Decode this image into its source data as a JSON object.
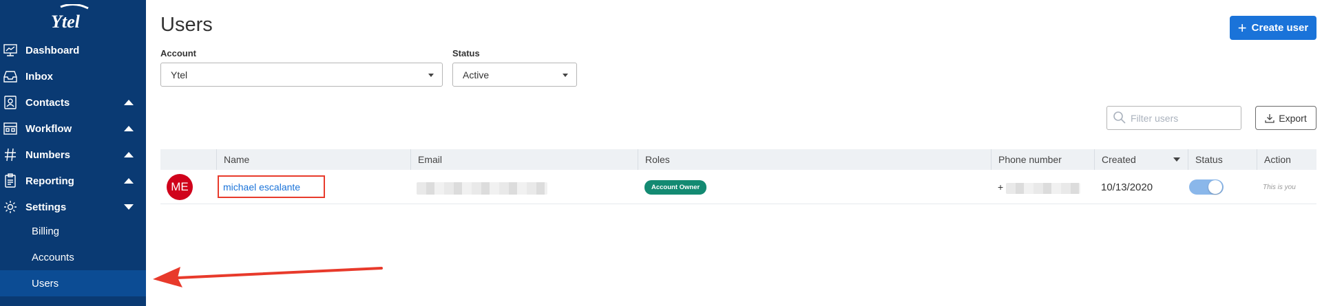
{
  "sidebar": {
    "logo_text": "Ytel",
    "items": [
      {
        "label": "Dashboard",
        "icon": "dashboard-icon"
      },
      {
        "label": "Inbox",
        "icon": "inbox-icon"
      },
      {
        "label": "Contacts",
        "icon": "contacts-icon",
        "caret": "up"
      },
      {
        "label": "Workflow",
        "icon": "workflow-icon",
        "caret": "up"
      },
      {
        "label": "Numbers",
        "icon": "hash-icon",
        "caret": "up"
      },
      {
        "label": "Reporting",
        "icon": "reporting-icon",
        "caret": "up"
      },
      {
        "label": "Settings",
        "icon": "gear-icon",
        "caret": "down"
      }
    ],
    "sub_items": [
      {
        "label": "Billing"
      },
      {
        "label": "Accounts"
      },
      {
        "label": "Users",
        "active": true
      }
    ]
  },
  "header": {
    "title": "Users",
    "create_label": "Create user"
  },
  "filters": {
    "account_label": "Account",
    "account_value": "Ytel",
    "status_label": "Status",
    "status_value": "Active",
    "search_placeholder": "Filter users",
    "export_label": "Export"
  },
  "table": {
    "columns": [
      "Name",
      "Email",
      "Roles",
      "Phone number",
      "Created",
      "Status",
      "Action"
    ],
    "rows": [
      {
        "initials": "ME",
        "name": "michael escalante",
        "email": "",
        "role": "Account Owner",
        "phone_prefix": "+",
        "created": "10/13/2020",
        "status_on": true,
        "action": "This is you"
      }
    ]
  },
  "colors": {
    "sidebar_bg": "#0a3a73",
    "sidebar_active": "#0c4c94",
    "primary": "#1a73d9",
    "avatar": "#d0021b",
    "role_badge": "#138a72",
    "annotation": "#e83a2b"
  }
}
